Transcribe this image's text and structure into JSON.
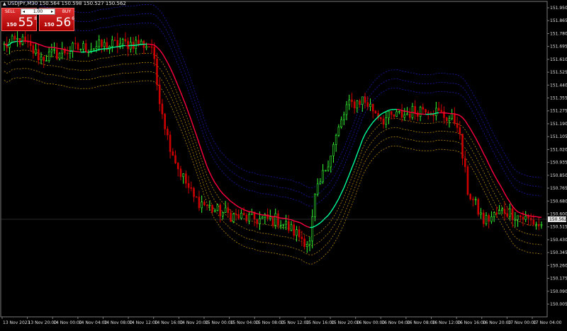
{
  "window": {
    "title": "USDJPY,M30  150.564 150.598 150.527 150.562"
  },
  "trade_panel": {
    "sell_label": "SELL",
    "buy_label": "BUY",
    "lot_value": "1.00",
    "sell_prefix": "150",
    "sell_main": "55",
    "sell_sup": "8",
    "buy_prefix": "150",
    "buy_main": "56",
    "buy_sup": "6"
  },
  "chart_data": {
    "type": "line",
    "symbol": "USDJPY",
    "timeframe": "M30",
    "current_price": "150.562",
    "price_axis_ticks": [
      "151.950",
      "151.865",
      "151.780",
      "151.695",
      "151.610",
      "151.525",
      "151.440",
      "151.355",
      "151.275",
      "151.190",
      "151.105",
      "151.020",
      "150.935",
      "150.850",
      "150.765",
      "150.680",
      "150.600",
      "150.515",
      "150.430",
      "150.345",
      "150.260",
      "150.175",
      "150.090",
      "150.005"
    ],
    "time_axis_ticks": [
      "13 Nov 2023",
      "13 Nov 20:00",
      "14 Nov 00:00",
      "14 Nov 04:00",
      "14 Nov 08:00",
      "14 Nov 12:00",
      "14 Nov 16:00",
      "14 Nov 20:00",
      "15 Nov 00:00",
      "15 Nov 04:00",
      "15 Nov 08:00",
      "15 Nov 12:00",
      "15 Nov 16:00",
      "15 Nov 20:00",
      "16 Nov 00:00",
      "16 Nov 04:00",
      "16 Nov 08:00",
      "16 Nov 12:00",
      "16 Nov 16:00",
      "16 Nov 20:00",
      "17 Nov 00:00",
      "17 Nov 04:00"
    ],
    "ylim": [
      150.005,
      151.95
    ],
    "price_keypoints": [
      [
        0,
        151.7
      ],
      [
        6,
        151.74
      ],
      [
        14,
        151.62
      ],
      [
        26,
        151.68
      ],
      [
        38,
        151.7
      ],
      [
        50,
        151.72
      ],
      [
        56,
        151.7
      ],
      [
        58,
        151.45
      ],
      [
        62,
        151.1
      ],
      [
        66,
        150.9
      ],
      [
        72,
        150.7
      ],
      [
        80,
        150.62
      ],
      [
        88,
        150.58
      ],
      [
        96,
        150.56
      ],
      [
        104,
        150.56
      ],
      [
        110,
        150.48
      ],
      [
        116,
        150.4
      ],
      [
        118,
        150.7
      ],
      [
        124,
        151.0
      ],
      [
        130,
        151.3
      ],
      [
        136,
        151.35
      ],
      [
        144,
        151.22
      ],
      [
        152,
        151.25
      ],
      [
        160,
        151.3
      ],
      [
        166,
        151.25
      ],
      [
        172,
        151.2
      ],
      [
        176,
        150.75
      ],
      [
        182,
        150.55
      ],
      [
        190,
        150.62
      ],
      [
        196,
        150.58
      ],
      [
        204,
        150.52
      ]
    ],
    "colors": {
      "background": "#000000",
      "grid": "#7a7a7a",
      "candle_bull": "#33ff33",
      "candle_bear": "#cc0000",
      "ma_up": "#00ff99",
      "ma_down": "#ff0040",
      "band_outer": "#1a1aa8",
      "band_inner": "#b8860b",
      "axis_text": "#e0e0e0"
    }
  }
}
